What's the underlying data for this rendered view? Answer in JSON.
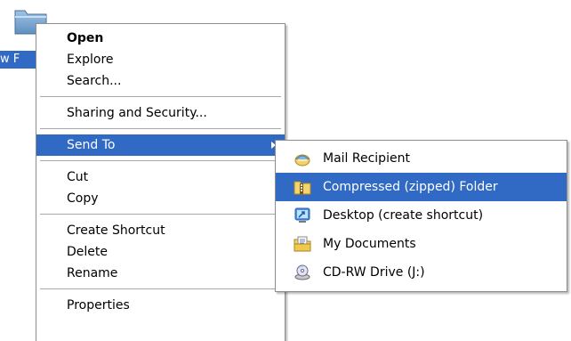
{
  "desktop": {
    "folder_label": "w F",
    "folder_icon": "folder-icon"
  },
  "context_menu": {
    "items": [
      {
        "label": "Open",
        "bold": true
      },
      {
        "label": "Explore"
      },
      {
        "label": "Search..."
      },
      {
        "separator": true
      },
      {
        "label": "Sharing and Security..."
      },
      {
        "separator": true
      },
      {
        "label": "Send To",
        "selected": true,
        "has_submenu": true
      },
      {
        "separator": true
      },
      {
        "label": "Cut"
      },
      {
        "label": "Copy"
      },
      {
        "separator": true
      },
      {
        "label": "Create Shortcut"
      },
      {
        "label": "Delete"
      },
      {
        "label": "Rename"
      },
      {
        "separator": true
      },
      {
        "label": "Properties"
      }
    ],
    "selection_color": "#316ac5"
  },
  "send_to_menu": {
    "items": [
      {
        "label": "Mail Recipient",
        "icon": "mail-recipient-icon"
      },
      {
        "label": "Compressed (zipped) Folder",
        "icon": "zipped-folder-icon",
        "selected": true
      },
      {
        "label": "Desktop (create shortcut)",
        "icon": "desktop-shortcut-icon"
      },
      {
        "label": "My Documents",
        "icon": "my-documents-icon"
      },
      {
        "label": "CD-RW Drive (J:)",
        "icon": "cd-drive-icon"
      }
    ]
  }
}
